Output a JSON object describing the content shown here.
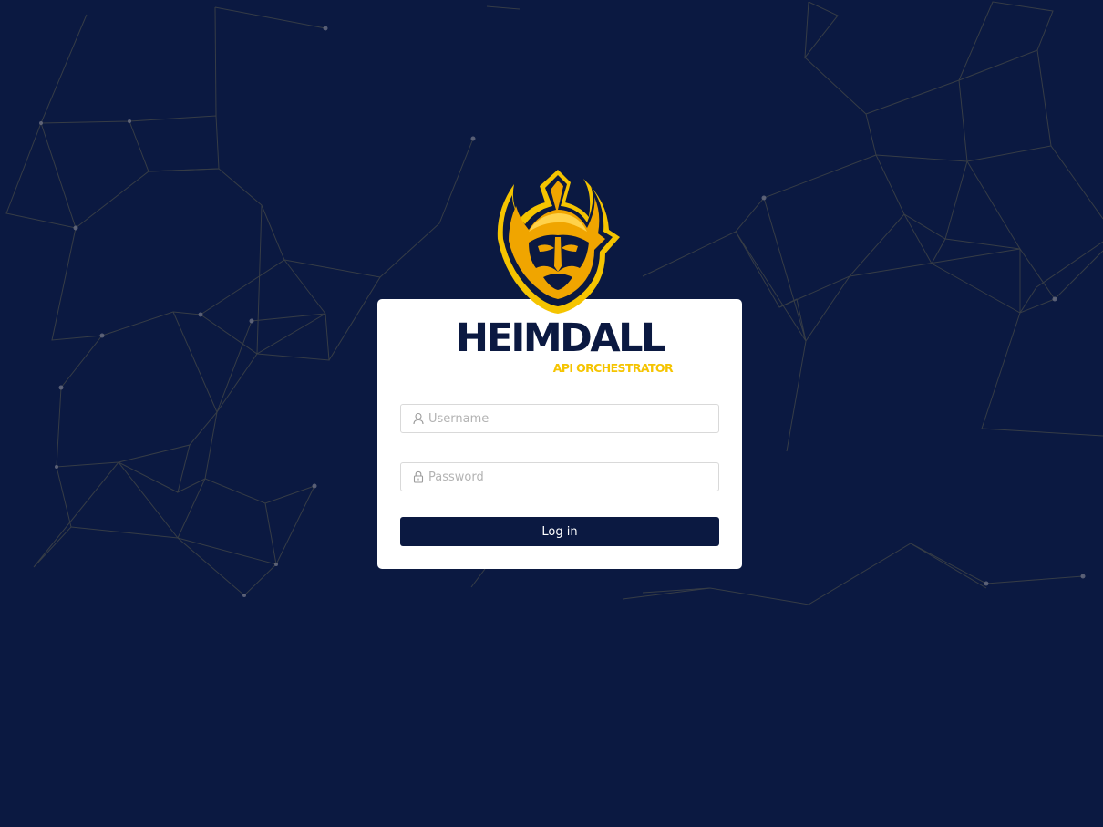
{
  "brand": {
    "title": "HEIMDALL",
    "subtitle": "API ORCHESTRATOR",
    "logo_icon": "viking-helmet-logo-icon"
  },
  "login_form": {
    "username": {
      "icon": "user-icon",
      "placeholder": "Username",
      "value": ""
    },
    "password": {
      "icon": "lock-icon",
      "placeholder": "Password",
      "value": ""
    },
    "submit_label": "Log in"
  },
  "colors": {
    "background": "#0b1941",
    "card": "#ffffff",
    "accent_yellow": "#f5c400",
    "accent_orange": "#f0a500",
    "button": "#0b1941",
    "button_text": "#ffffff"
  }
}
